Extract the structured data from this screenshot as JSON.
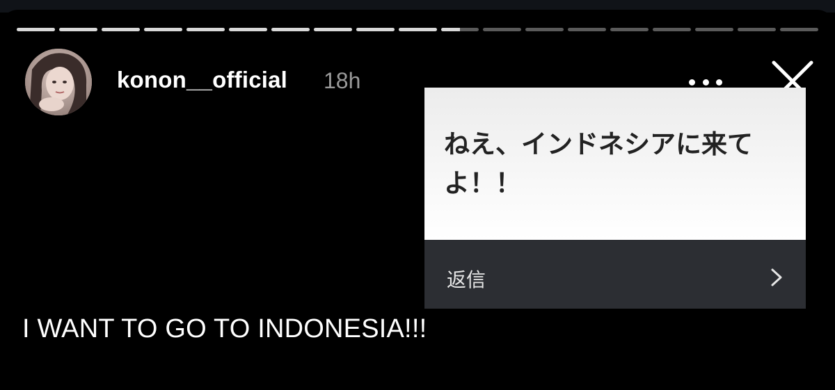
{
  "story": {
    "progress": {
      "segment_count": 19,
      "viewed_segments": 10,
      "current_segment_progress": 0.5
    },
    "header": {
      "username": "konon__official",
      "timestamp": "18h",
      "more_icon": "more-horizontal-icon",
      "close_icon": "close-icon"
    },
    "question_card": {
      "question": "ねえ、インドネシアに来てよ！！",
      "reply_label": "返信",
      "reply_icon": "chevron-right-icon"
    },
    "caption": "I WANT TO GO TO INDONESIA!!!"
  },
  "colors": {
    "background": "#000000",
    "progress_filled": "#d8d8d8",
    "progress_empty": "#5a5a5a",
    "card_dark": "#2c2e33",
    "timestamp": "#9a9a9a"
  }
}
